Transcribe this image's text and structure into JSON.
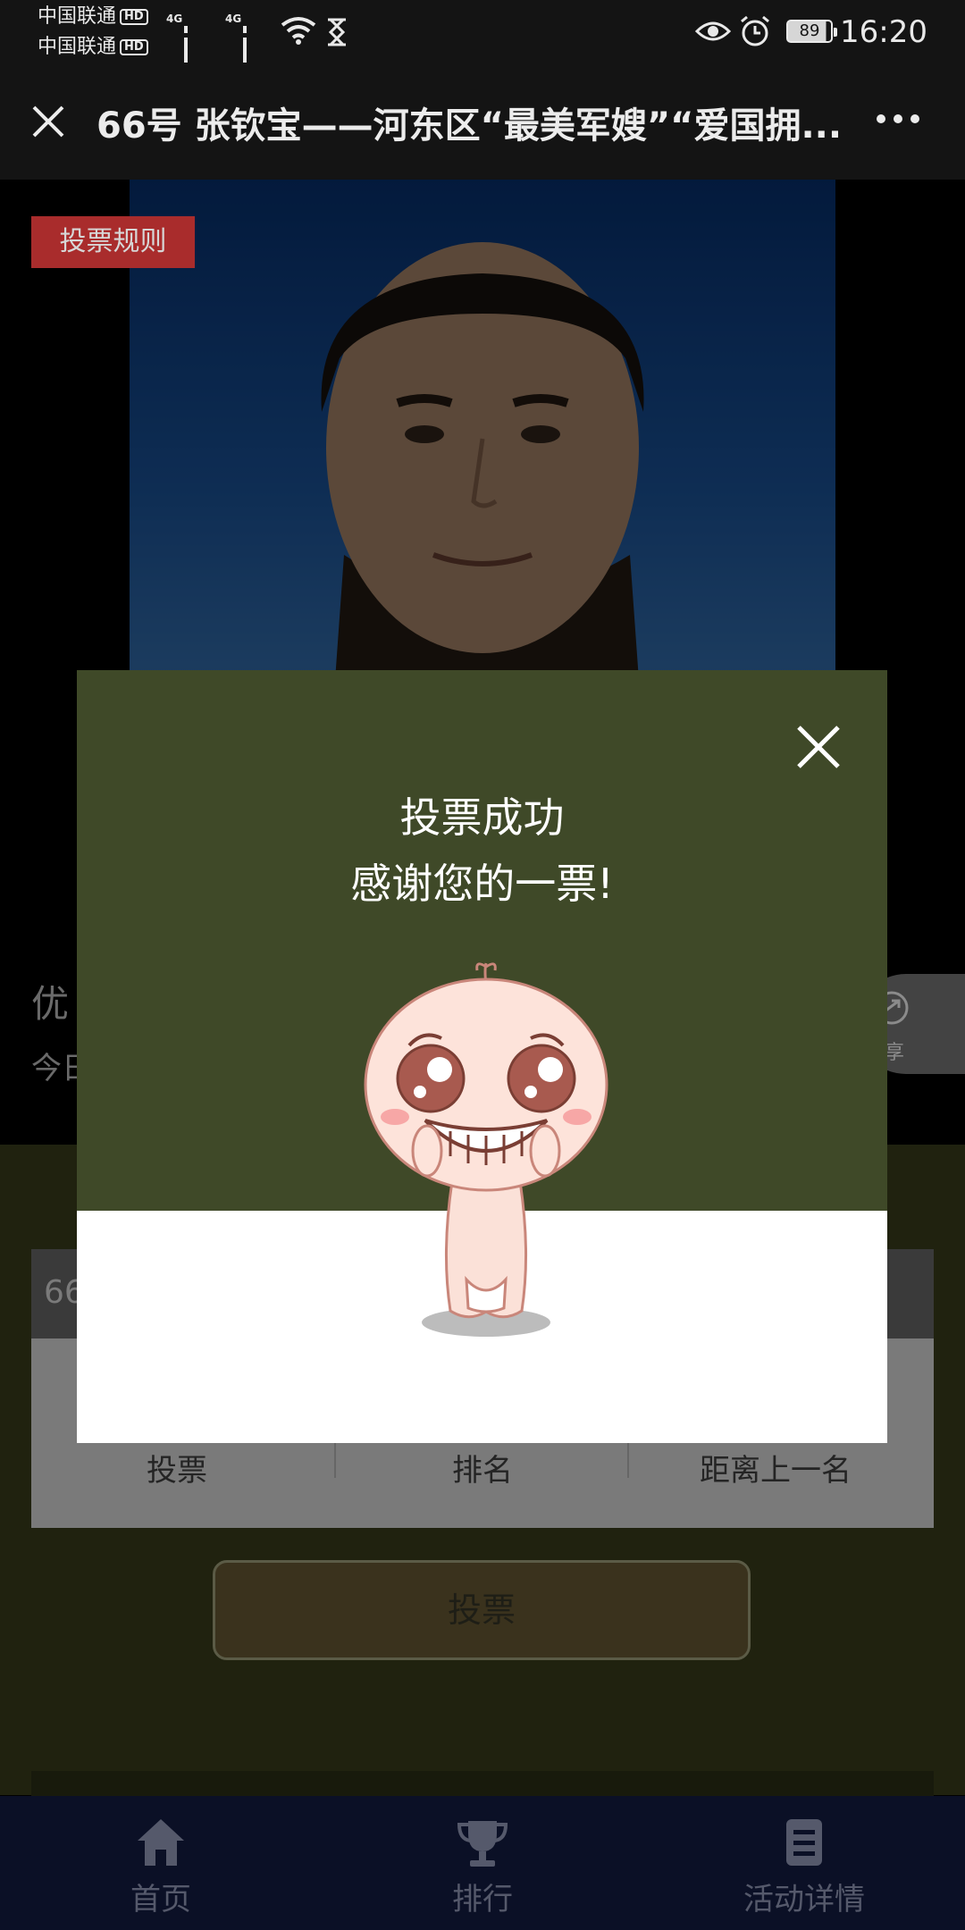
{
  "status_bar": {
    "carrier_1": "中国联通",
    "carrier_2": "中国联通",
    "hd_badge": "HD",
    "network_1": "4G",
    "network_2": "4G",
    "battery": "89",
    "time": "16:20",
    "icons": [
      "wifi-icon",
      "hourglass-icon",
      "eye-icon",
      "alarm-icon",
      "battery-icon"
    ]
  },
  "title_bar": {
    "title": "66号 张钦宝——河东区“最美军嫂”“爱国拥...",
    "close_icon": "close-icon",
    "more_icon": "more-icon"
  },
  "page": {
    "rules_badge": "投票规则",
    "partial_text_1": "优",
    "partial_text_2": "今日",
    "share_label": "享",
    "search_value": "66",
    "stats": {
      "labels": [
        "投票",
        "排名",
        "距离上一名"
      ]
    },
    "vote_button": "投票"
  },
  "modal": {
    "title_line1": "投票成功",
    "title_line2": "感谢您的一票!",
    "close_icon": "close-icon",
    "illustration": "mascot-grin"
  },
  "bottom_nav": {
    "items": [
      {
        "label": "首页",
        "icon": "home-icon"
      },
      {
        "label": "排行",
        "icon": "trophy-icon"
      },
      {
        "label": "活动详情",
        "icon": "notebook-icon"
      }
    ]
  },
  "colors": {
    "modal_header": "#3f4928",
    "rules_badge": "#a92c2c",
    "nav_bg": "#0b1026"
  }
}
